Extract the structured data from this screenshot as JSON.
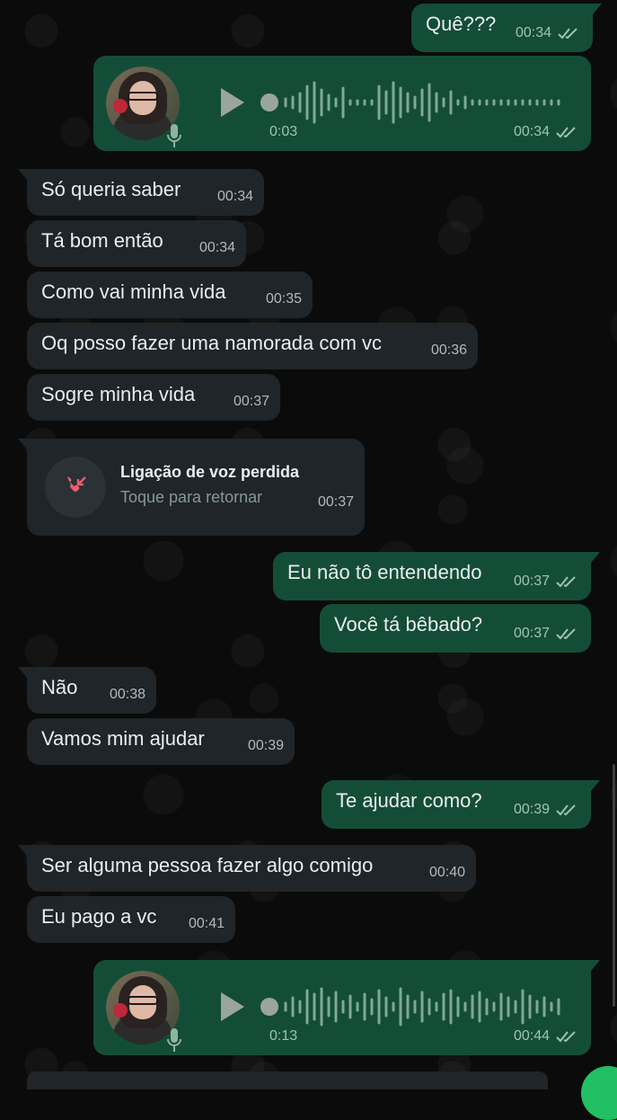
{
  "messages": [
    {
      "text": "Quê???",
      "time": "00:34"
    },
    {
      "duration": "0:03",
      "time": "00:34"
    },
    {
      "text": "Só queria saber",
      "time": "00:34"
    },
    {
      "text": "Tá bom então",
      "time": "00:34"
    },
    {
      "text": "Como vai minha vida",
      "time": "00:35"
    },
    {
      "text": "Oq posso fazer uma namorada com vc",
      "time": "00:36"
    },
    {
      "text": "Sogre minha vida",
      "time": "00:37"
    },
    {
      "title": "Ligação de voz perdida",
      "subtitle": "Toque para retornar",
      "time": "00:37"
    },
    {
      "text": "Eu não tô entendendo",
      "time": "00:37"
    },
    {
      "text": "Você tá bêbado?",
      "time": "00:37"
    },
    {
      "text": "Não",
      "time": "00:38"
    },
    {
      "text": "Vamos mim ajudar",
      "time": "00:39"
    },
    {
      "text": "Te ajudar como?",
      "time": "00:39"
    },
    {
      "text": "Ser alguma pessoa  fazer algo comigo",
      "time": "00:40"
    },
    {
      "text": "Eu pago a vc",
      "time": "00:41"
    },
    {
      "duration": "0:13",
      "time": "00:44"
    }
  ],
  "icons": {
    "read": "double-check-icon",
    "play": "play-icon",
    "mic": "mic-icon",
    "missed_call": "missed-call-icon"
  },
  "colors": {
    "incoming_bubble": "#1f2528",
    "outgoing_bubble": "#144d37",
    "read_ticks": "#9fc3b2",
    "missed_call": "#f15c6d"
  }
}
